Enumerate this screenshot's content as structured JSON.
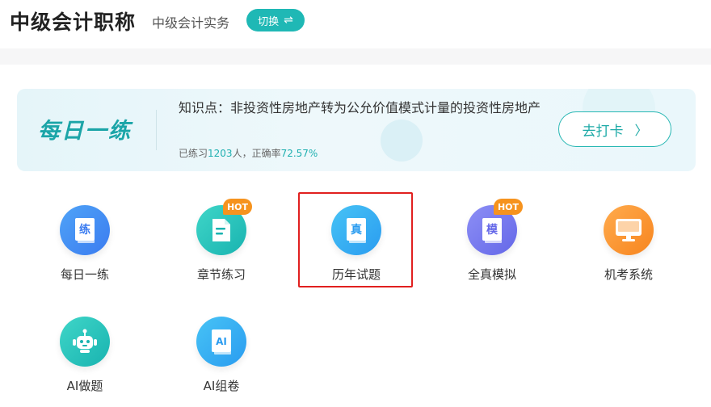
{
  "header": {
    "title": "中级会计职称",
    "subtitle": "中级会计实务",
    "switch_label": "切换",
    "switch_icon": "swap-arrows-icon"
  },
  "daily": {
    "logo": "每日一练",
    "knowledge_point": "知识点：非投资性房地产转为公允价值模式计量的投资性房地产",
    "stats_prefix": "已练习",
    "practiced_count": "1203",
    "stats_middle": "人，正确率",
    "accuracy": "72.57%",
    "checkin_label": "去打卡",
    "checkin_icon": "chevron-right-icon"
  },
  "grid": {
    "items": [
      {
        "label": "每日一练",
        "icon_char": "练",
        "icon": "practice-book-icon",
        "colors": [
          "#4fa3f7",
          "#3b7cf0"
        ],
        "hot": false
      },
      {
        "label": "章节练习",
        "icon_char": "",
        "icon": "document-icon",
        "colors": [
          "#3fd6c8",
          "#19b3b0"
        ],
        "hot": true
      },
      {
        "label": "历年试题",
        "icon_char": "真",
        "icon": "past-exam-book-icon",
        "colors": [
          "#47c3f5",
          "#2a9cf0"
        ],
        "hot": false
      },
      {
        "label": "全真模拟",
        "icon_char": "模",
        "icon": "mock-exam-book-icon",
        "colors": [
          "#8d8ff5",
          "#6467e8"
        ],
        "hot": true
      },
      {
        "label": "机考系统",
        "icon_char": "",
        "icon": "computer-monitor-icon",
        "colors": [
          "#ffab4d",
          "#f7851f"
        ],
        "hot": false
      },
      {
        "label": "AI做题",
        "icon_char": "",
        "icon": "robot-icon",
        "colors": [
          "#3fd6c8",
          "#19b3b0"
        ],
        "hot": false
      },
      {
        "label": "AI组卷",
        "icon_char": "AI",
        "icon": "ai-paper-icon",
        "colors": [
          "#47c3f5",
          "#2a9cf0"
        ],
        "hot": false
      }
    ],
    "hot_label": "HOT",
    "selected_item": "历年试题"
  }
}
